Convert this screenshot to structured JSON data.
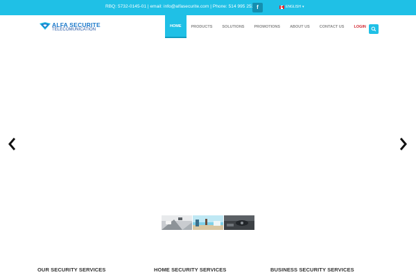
{
  "topbar": {
    "contact_info": "RBQ: 5732-0145-01 | email: info@alfasecurite.com | Phone: 514 995 2532",
    "facebook_glyph": "f",
    "language": "ENGLISH",
    "language_caret": "▾"
  },
  "logo": {
    "line1": "ALFA SECURITE",
    "line2": "TELECOMUNICATION"
  },
  "nav": {
    "items": [
      {
        "label": "HOME"
      },
      {
        "label": "PRODUCTS"
      },
      {
        "label": "SOLUTIONS"
      },
      {
        "label": "PROMOTIONS"
      },
      {
        "label": "ABOUT US"
      },
      {
        "label": "CONTACT US"
      },
      {
        "label": "LOGIN"
      }
    ],
    "active_index": 0
  },
  "icons": {
    "search": "search-icon",
    "prev": "chevron-left-icon",
    "next": "chevron-right-icon",
    "facebook": "facebook-icon",
    "flag": "canada-flag-icon"
  },
  "services": {
    "col1": "OUR SECURITY SERVICES",
    "col2": "HOME SECURITY SERVICES",
    "col3": "BUSINESS SECURITY SERVICES"
  },
  "colors": {
    "accent": "#1fc0e6",
    "login": "#d0202a",
    "logo_blue": "#1877c9"
  }
}
